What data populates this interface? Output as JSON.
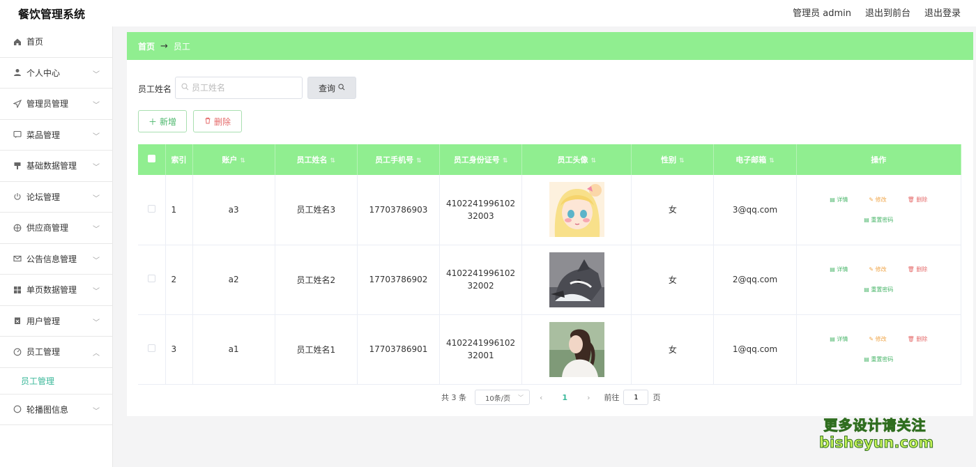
{
  "header": {
    "brand": "餐饮管理系统",
    "admin": "管理员 admin",
    "to_front": "退出到前台",
    "logout": "退出登录"
  },
  "sidebar": {
    "items": [
      {
        "label": "首页",
        "icon": "home-icon",
        "expandable": false
      },
      {
        "label": "个人中心",
        "icon": "user-icon",
        "expandable": true
      },
      {
        "label": "管理员管理",
        "icon": "send-icon",
        "expandable": true
      },
      {
        "label": "菜品管理",
        "icon": "chat-icon",
        "expandable": true
      },
      {
        "label": "基础数据管理",
        "icon": "stamp-icon",
        "expandable": true
      },
      {
        "label": "论坛管理",
        "icon": "power-icon",
        "expandable": true
      },
      {
        "label": "供应商管理",
        "icon": "compass-icon",
        "expandable": true
      },
      {
        "label": "公告信息管理",
        "icon": "mail-icon",
        "expandable": true
      },
      {
        "label": "单页数据管理",
        "icon": "grid-icon",
        "expandable": true
      },
      {
        "label": "用户管理",
        "icon": "clipboard-icon",
        "expandable": true
      },
      {
        "label": "员工管理",
        "icon": "dashboard-icon",
        "expandable": true,
        "expanded": true
      },
      {
        "label": "轮播图信息",
        "icon": "navigation-icon",
        "expandable": true
      }
    ],
    "submenu_label": "员工管理"
  },
  "breadcrumb": {
    "home": "首页",
    "arrow": "→",
    "current": "员工"
  },
  "search": {
    "label": "员工姓名",
    "placeholder": "员工姓名",
    "button": "查询"
  },
  "actions": {
    "add": "新增",
    "delete": "删除"
  },
  "table": {
    "headers": [
      "索引",
      "账户",
      "员工姓名",
      "员工手机号",
      "员工身份证号",
      "员工头像",
      "性别",
      "电子邮箱",
      "操作"
    ],
    "rows": [
      {
        "index": "1",
        "account": "a3",
        "name": "员工姓名3",
        "phone": "17703786903",
        "id_card": "410224199610232003",
        "avatar": "anime-girl",
        "gender": "女",
        "email": "3@qq.com"
      },
      {
        "index": "2",
        "account": "a2",
        "name": "员工姓名2",
        "phone": "17703786902",
        "id_card": "410224199610232002",
        "avatar": "husky-dog",
        "gender": "女",
        "email": "2@qq.com"
      },
      {
        "index": "3",
        "account": "a1",
        "name": "员工姓名1",
        "phone": "17703786901",
        "id_card": "410224199610232001",
        "avatar": "girl-photo",
        "gender": "女",
        "email": "1@qq.com"
      }
    ],
    "ops": {
      "detail": "详情",
      "edit": "修改",
      "remove": "删除",
      "reset": "重置密码"
    }
  },
  "pagination": {
    "total": "共 3 条",
    "page_size": "10条/页",
    "prev": "‹",
    "current": "1",
    "next": "›",
    "goto": "前往",
    "goto_value": "1",
    "page_suffix": "页"
  },
  "watermark": {
    "line1": "更多设计请关注",
    "line2": "bisheyun.com"
  },
  "colors": {
    "accent": "#90ee90",
    "teal": "#3bb89a",
    "danger": "#e56b6b",
    "warning": "#f0a64a"
  }
}
